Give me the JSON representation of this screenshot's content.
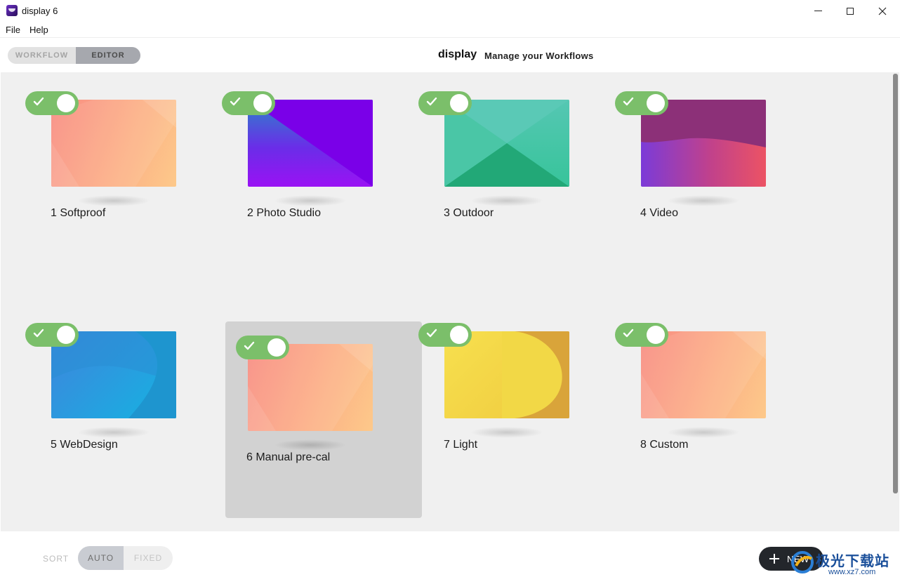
{
  "window": {
    "title": "display 6",
    "icon": "app-logo-icon"
  },
  "menu": {
    "file": "File",
    "help": "Help"
  },
  "header": {
    "modes": [
      "WORKFLOW",
      "EDITOR"
    ],
    "active_mode": "EDITOR",
    "brand": "display",
    "subtitle": "Manage your Workflows"
  },
  "workflows": [
    {
      "label": "1 Softproof",
      "enabled": true,
      "selected": false
    },
    {
      "label": "2 Photo Studio",
      "enabled": true,
      "selected": false
    },
    {
      "label": "3 Outdoor",
      "enabled": true,
      "selected": false
    },
    {
      "label": "4 Video",
      "enabled": true,
      "selected": false
    },
    {
      "label": "5 WebDesign",
      "enabled": true,
      "selected": false
    },
    {
      "label": "6 Manual pre-cal",
      "enabled": true,
      "selected": true
    },
    {
      "label": "7 Light",
      "enabled": true,
      "selected": false
    },
    {
      "label": "8 Custom",
      "enabled": true,
      "selected": false
    }
  ],
  "footer": {
    "sort_label": "SORT",
    "sort_options": [
      "AUTO",
      "FIXED"
    ],
    "sort_active": "AUTO",
    "new_button": "NEW"
  },
  "watermark": {
    "title": "极光下载站",
    "url": "www.xz7.com"
  },
  "colors": {
    "toggle_on": "#7bbf6a",
    "selected_card": "#d2d2d2",
    "new_button_bg": "#23262b"
  }
}
